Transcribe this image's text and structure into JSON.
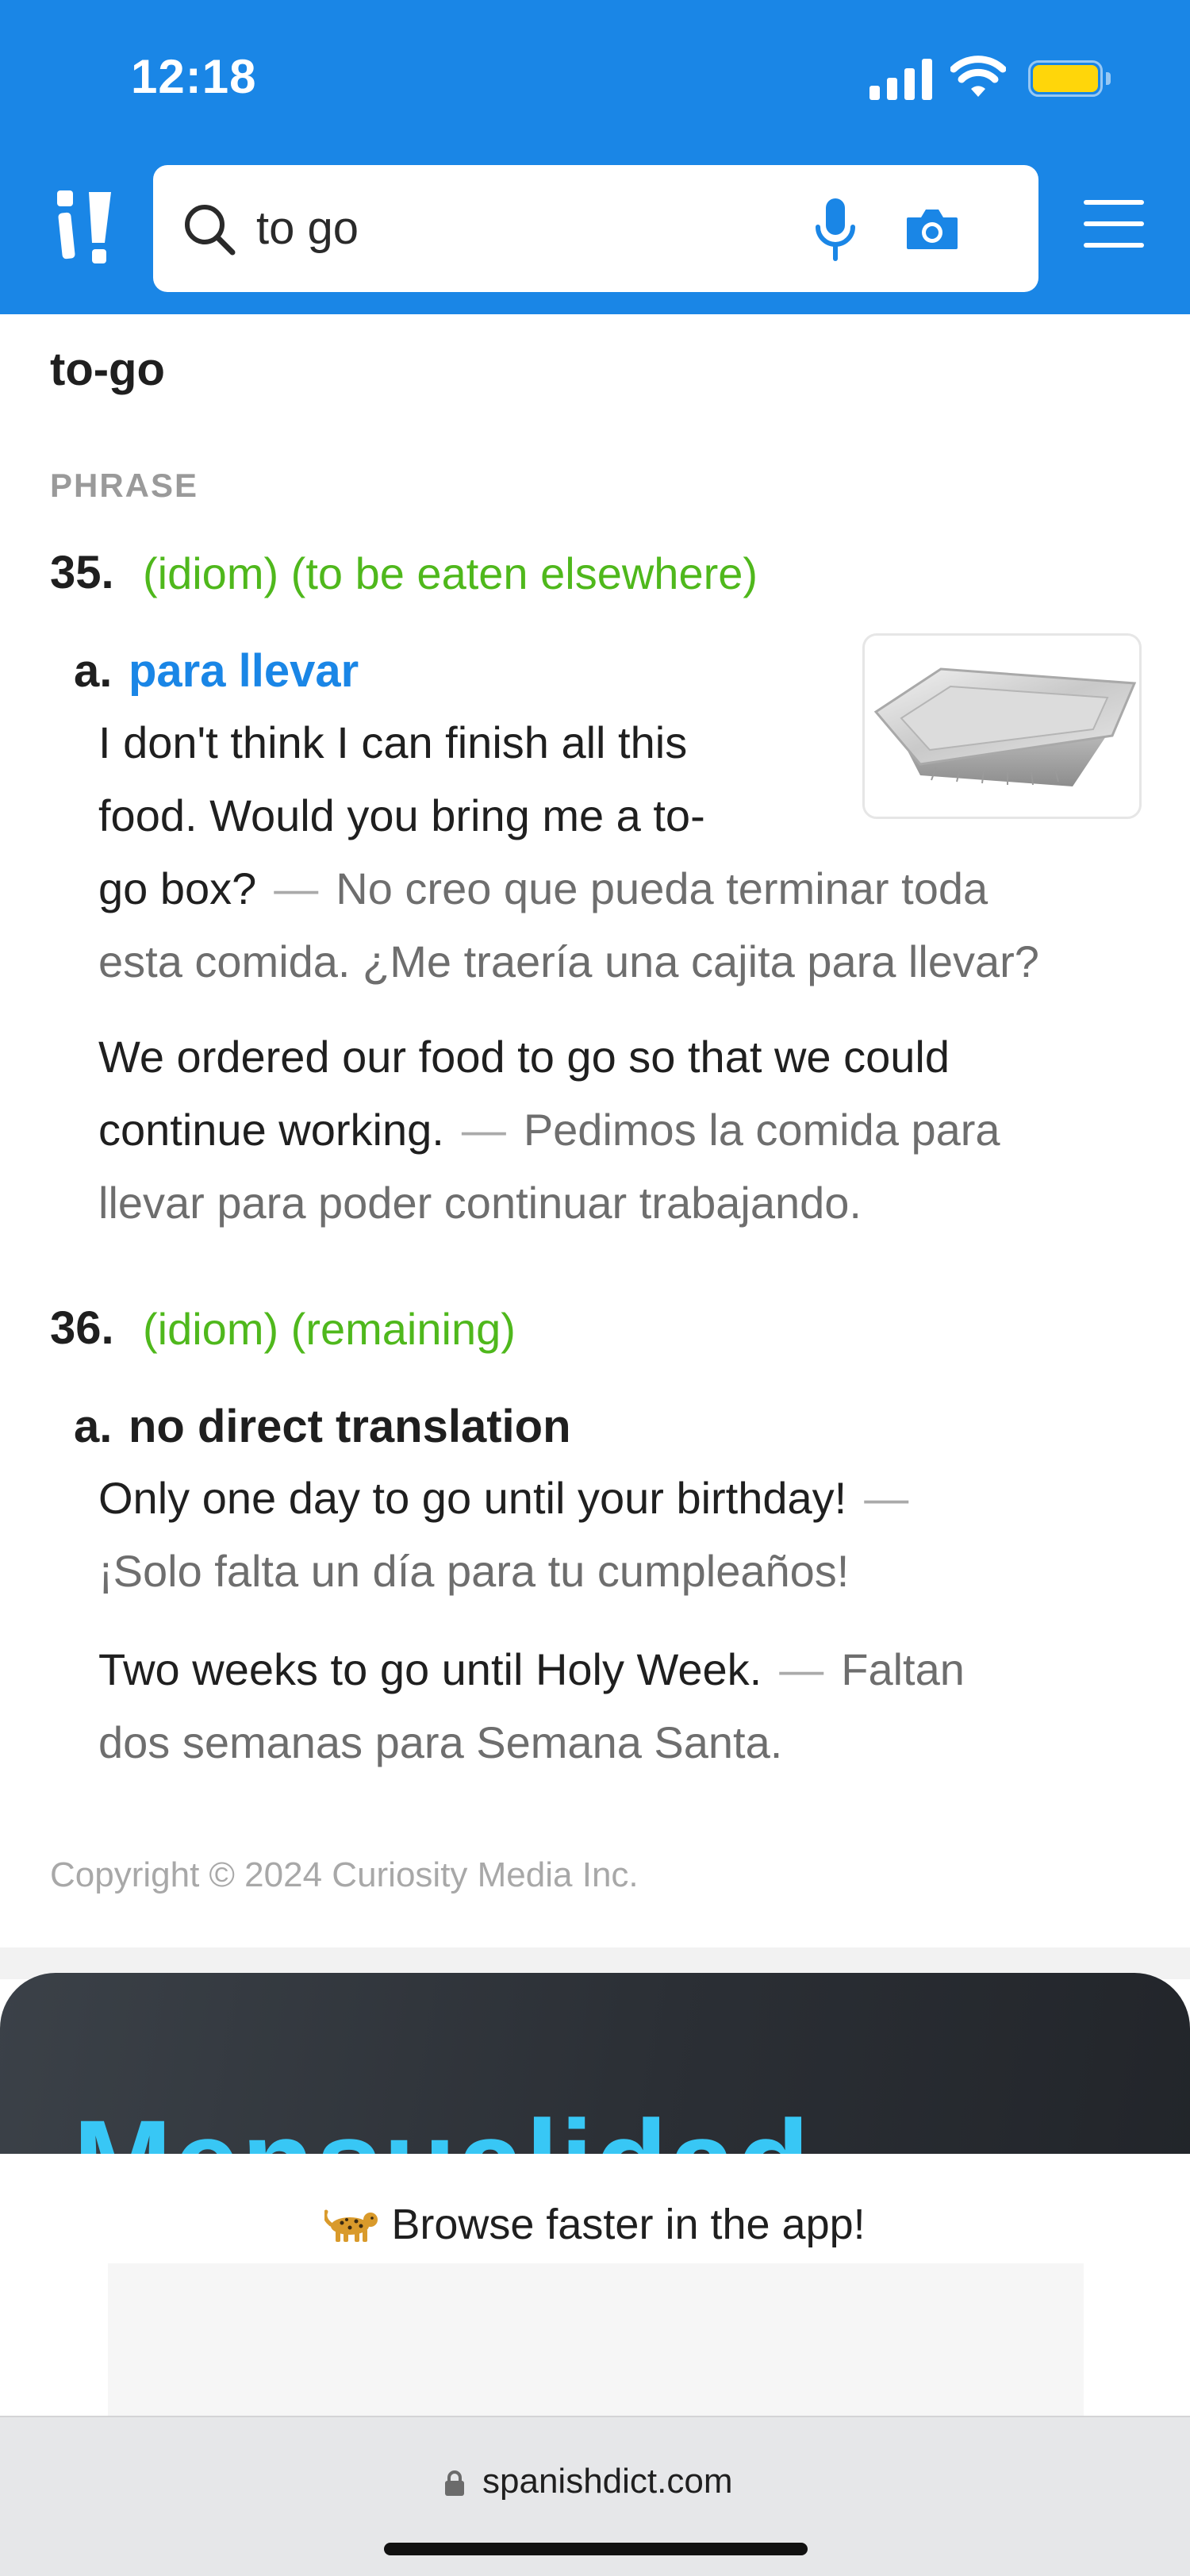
{
  "status_bar": {
    "time": "12:18",
    "icons": [
      "cellular-signal-icon",
      "wifi-icon",
      "battery-icon"
    ],
    "battery_color": "#ffd60a"
  },
  "header": {
    "background_color": "#1a86e6",
    "logo_icon": "spanishdict-logo-icon",
    "search": {
      "value": "to go",
      "icons": [
        "search-icon",
        "microphone-icon",
        "camera-icon"
      ]
    },
    "menu_icon": "hamburger-menu-icon"
  },
  "entry": {
    "headword": "to-go",
    "part_of_speech": "PHRASE",
    "senses": [
      {
        "number": "35.",
        "description": "(idiom) (to be eaten elsewhere)",
        "subsenses": [
          {
            "letter": "a.",
            "translation": "para llevar",
            "image_icon": "takeout-container-image",
            "examples": [
              {
                "en_lines": [
                  "I don't think I can finish all this",
                  "food. Would you bring me a to-",
                  "go box?"
                ],
                "dash": "—",
                "es_first": "No creo que pueda terminar toda",
                "es_rest": "esta comida. ¿Me traería una cajita para llevar?"
              },
              {
                "en_lines": [
                  "We ordered our food to go so that we could",
                  "continue working."
                ],
                "dash": "—",
                "es_first": "Pedimos la comida para",
                "es_rest": "llevar para poder continuar trabajando."
              }
            ]
          }
        ]
      },
      {
        "number": "36.",
        "description": "(idiom) (remaining)",
        "subsenses": [
          {
            "letter": "a.",
            "translation": "no direct translation",
            "examples": [
              {
                "en": "Only one day to go until your birthday!",
                "dash": "—",
                "es": "¡Solo falta un día para tu cumpleaños!"
              },
              {
                "en": "Two weeks to go until Holy Week.",
                "dash": "—",
                "es_first": "Faltan",
                "es_rest": "dos semanas para Semana Santa."
              }
            ]
          }
        ]
      }
    ],
    "copyright": "Copyright © 2024 Curiosity Media Inc."
  },
  "promo": {
    "title": "Mensualidad",
    "title_color": "#38c7f5"
  },
  "app_banner": {
    "icon": "cheetah-icon",
    "text": "Browse faster in the app!"
  },
  "browser_bar": {
    "lock_icon": "lock-icon",
    "url": "spanishdict.com"
  },
  "colors": {
    "idiom_green": "#4fb81c",
    "link_blue": "#1a86e6",
    "spanish_gray": "#6e6e6e"
  }
}
